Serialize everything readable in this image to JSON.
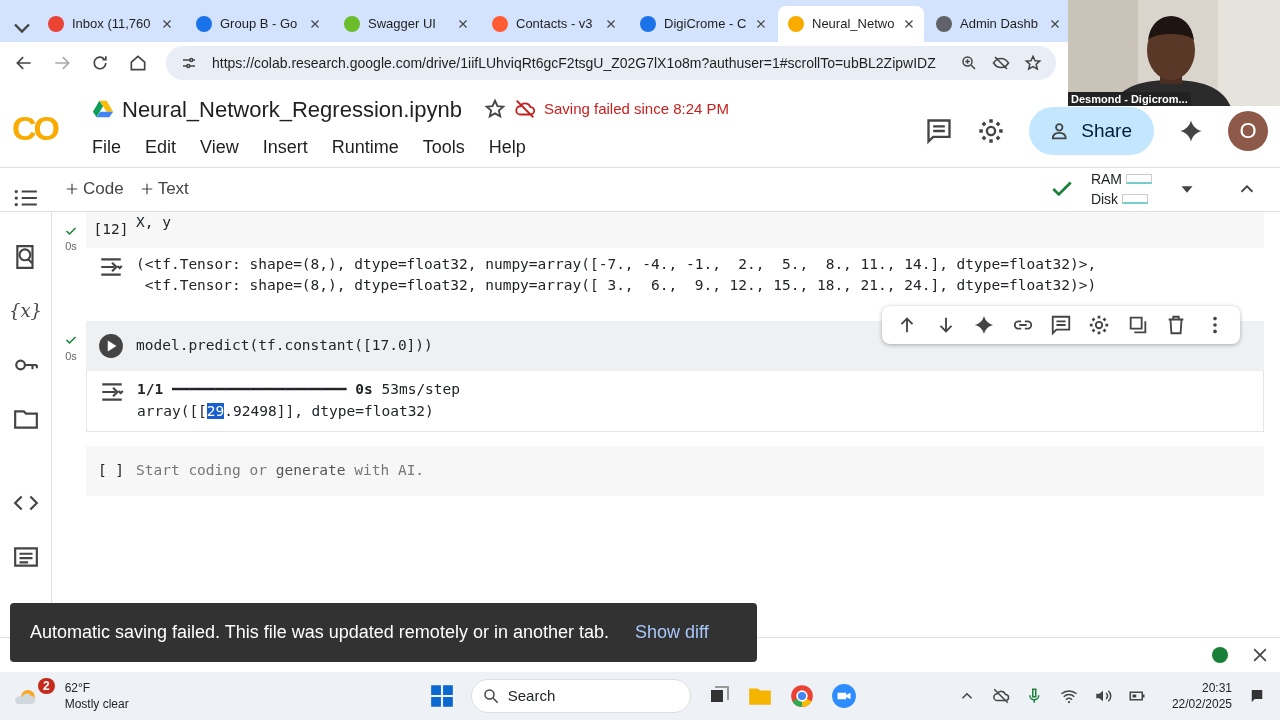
{
  "browser": {
    "tabs": [
      {
        "label": "Inbox (11,760",
        "selected": false,
        "color": "#ea4335"
      },
      {
        "label": "Group B - Go",
        "selected": false,
        "color": "#1a73e8"
      },
      {
        "label": "Swagger UI",
        "selected": false,
        "color": "#6bbd2c"
      },
      {
        "label": "Contacts - v3",
        "selected": false,
        "color": "#ff5c35"
      },
      {
        "label": "DigiCrome - C",
        "selected": false,
        "color": "#1a73e8"
      },
      {
        "label": "Neural_Netwo",
        "selected": true,
        "color": "#f9ab00"
      },
      {
        "label": "Admin Dashb",
        "selected": false,
        "color": "#5f6368"
      }
    ],
    "url": "https://colab.research.google.com/drive/1iifLUhviqRt6gcF2tsgU_Z02G7lX1o8m?authuser=1#scrollTo=ubBL2ZipwIDZ"
  },
  "sidebar": {
    "variables_label": "{x}"
  },
  "webcam": {
    "caption": "Desmond - Digicrom..."
  },
  "notebook": {
    "logo": "CO",
    "title": "Neural_Network_Regression.ipynb",
    "save_status": "Saving failed since 8:24 PM",
    "share": "Share",
    "avatar": "O",
    "menu": [
      "File",
      "Edit",
      "View",
      "Insert",
      "Runtime",
      "Tools",
      "Help"
    ],
    "toolbar": [
      "Code",
      "Text"
    ],
    "resources": [
      "RAM",
      "Disk"
    ],
    "cells": [
      {
        "kind": "ran",
        "label": "[12]",
        "time": "0s",
        "code": "X, y",
        "output": [
          "(<tf.Tensor: shape=(8,), dtype=float32, numpy=array([-7., -4., -1.,  2.,  5.,  8., 11., 14.], dtype=float32)>,",
          " <tf.Tensor: shape=(8,), dtype=float32, numpy=array([ 3.,  6.,  9., 12., 15., 18., 21., 24.], dtype=float32)>)"
        ]
      },
      {
        "kind": "focused",
        "time": "0s",
        "code": "model.predict(tf.constant([17.0]))",
        "progress": "**1/1** ━━━━━━━━━━━━━━━━━━━━ **0s** 53ms/step",
        "result": {
          "before": "array([[",
          "selected": "29",
          "after": ".92498]], dtype=float32)"
        }
      },
      {
        "kind": "empty",
        "label": "[ ]",
        "placeholder_before": "Start coding or ",
        "link": "generate",
        "placeholder_after": " with AI."
      }
    ]
  },
  "toast": {
    "message": "Automatic saving failed. This file was updated remotely or in another tab.",
    "action": "Show diff"
  },
  "taskbar": {
    "badge": "2",
    "temperature": "62°F",
    "weather": "Mostly clear",
    "search": "Search",
    "time": "20:31",
    "date": "22/02/2025"
  }
}
